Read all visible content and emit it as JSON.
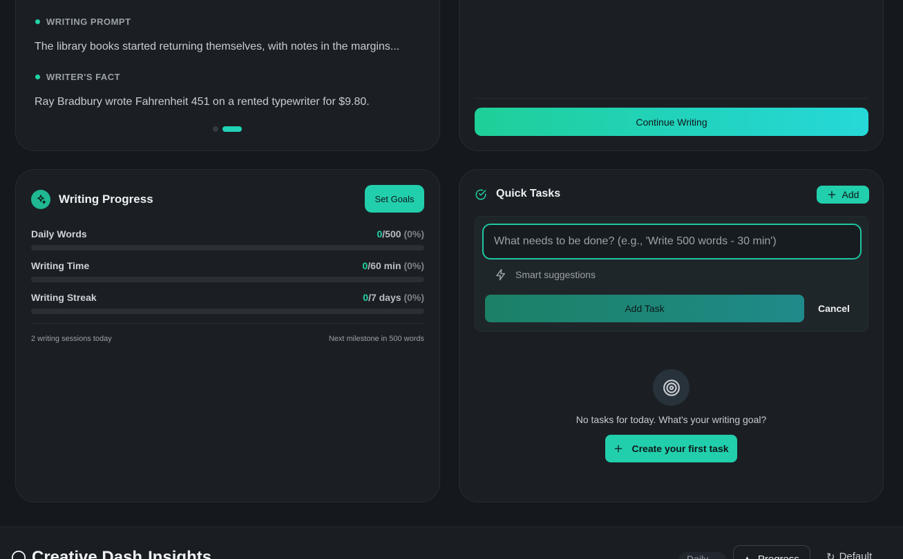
{
  "inspiration": {
    "prompt_label": "WRITING PROMPT",
    "prompt_text": "The library books started returning themselves, with notes in the margins...",
    "fact_label": "WRITER'S FACT",
    "fact_text": "Ray Bradbury wrote Fahrenheit 451 on a rented typewriter for $9.80.",
    "carousel": {
      "count": 2,
      "active_index": 1
    }
  },
  "continue": {
    "button_label": "Continue Writing"
  },
  "progress": {
    "title": "Writing Progress",
    "set_goals_label": "Set Goals",
    "metrics": [
      {
        "label": "Daily Words",
        "current": "0",
        "target": "/500",
        "percent": "(0%)",
        "fill": 0
      },
      {
        "label": "Writing Time",
        "current": "0",
        "target": "/60 min",
        "percent": "(0%)",
        "fill": 0
      },
      {
        "label": "Writing Streak",
        "current": "0",
        "target": "/7 days",
        "percent": "(0%)",
        "fill": 0
      }
    ],
    "sessions_text": "2 writing sessions today",
    "milestone_text": "Next milestone in 500 words"
  },
  "tasks": {
    "title": "Quick Tasks",
    "add_label": "Add",
    "input_placeholder": "What needs to be done? (e.g., 'Write 500 words - 30 min')",
    "input_value": "",
    "suggestions_label": "Smart suggestions",
    "add_task_label": "Add Task",
    "cancel_label": "Cancel",
    "empty_text": "No tasks for today. What's your writing goal?",
    "create_label": "Create your first task"
  },
  "bottom": {
    "title": "Creative Dash",
    "title_rest": "Insights",
    "pill1": "Daily",
    "pill2": "Progress",
    "default_label": "Default"
  },
  "colors": {
    "accent": "#22d3a5",
    "background": "#15181c",
    "card": "#1b1f24"
  }
}
